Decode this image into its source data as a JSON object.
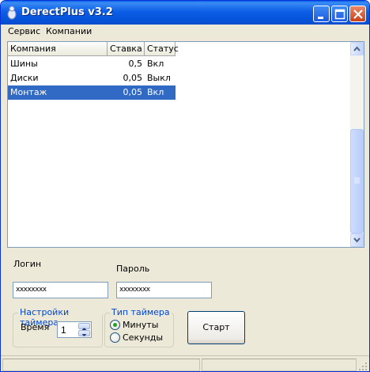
{
  "window": {
    "title": "DerectPlus v3.2",
    "accent": "#0553d9",
    "close_color": "#c9401a"
  },
  "menu": {
    "items": [
      "Сервис",
      "Компании"
    ]
  },
  "table": {
    "columns": [
      "Компания",
      "Ставка",
      "Статус"
    ],
    "rows": [
      {
        "company": "Шины",
        "rate": "0,5",
        "status": "Вкл",
        "selected": false
      },
      {
        "company": "Диски",
        "rate": "0,05",
        "status": "Выкл",
        "selected": false
      },
      {
        "company": "Монтаж",
        "rate": "0,05",
        "status": "Вкл",
        "selected": true
      }
    ],
    "selection_color": "#316ac5"
  },
  "form": {
    "login_label": "Логин",
    "login_value": "xxxxxxxx",
    "password_label": "Пароль",
    "password_value": "xxxxxxxx",
    "timer_settings": {
      "title": "Настройки таймера",
      "time_label": "Время",
      "time_value": "1"
    },
    "timer_type": {
      "title": "Тип таймера",
      "options": [
        "Минуты",
        "Секунды"
      ],
      "selected": "Минуты"
    },
    "start_button": "Старт"
  },
  "icons": [
    "app-icon",
    "minimize-icon",
    "maximize-icon",
    "close-icon",
    "scroll-up-arrow-icon",
    "scroll-down-arrow-icon",
    "spin-up-icon",
    "spin-down-icon",
    "resize-grip-icon"
  ]
}
